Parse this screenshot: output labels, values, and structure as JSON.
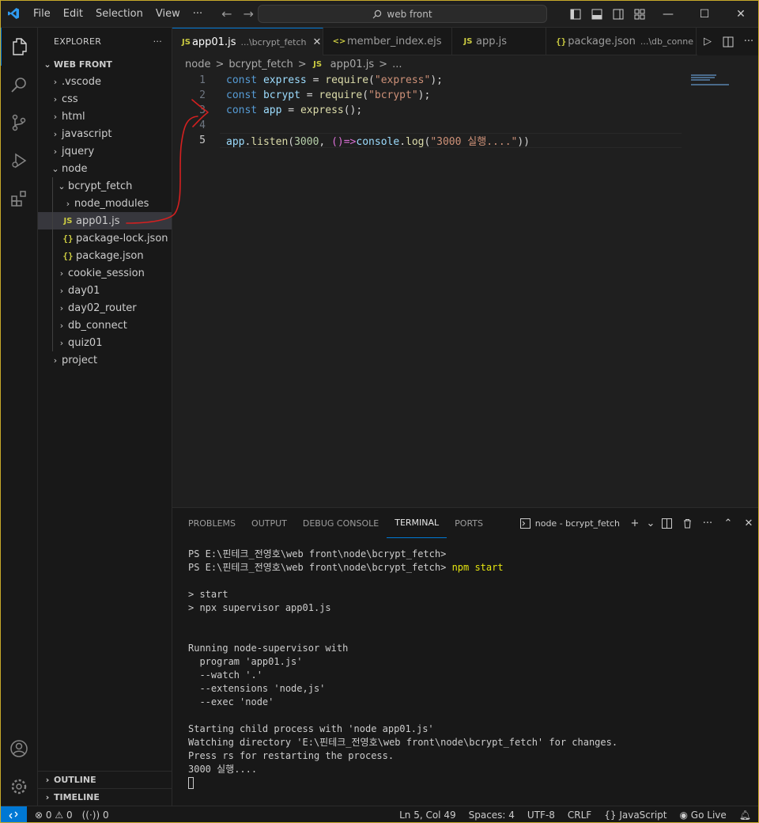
{
  "titlebar": {
    "menus": [
      "File",
      "Edit",
      "Selection",
      "View",
      "···"
    ],
    "search": "web front"
  },
  "sidebar": {
    "title": "EXPLORER",
    "more": "···",
    "folder": "WEB FRONT",
    "tree": [
      {
        "label": ".vscode",
        "level": 1,
        "type": "folder",
        "open": false
      },
      {
        "label": "css",
        "level": 1,
        "type": "folder",
        "open": false
      },
      {
        "label": "html",
        "level": 1,
        "type": "folder",
        "open": false
      },
      {
        "label": "javascript",
        "level": 1,
        "type": "folder",
        "open": false
      },
      {
        "label": "jquery",
        "level": 1,
        "type": "folder",
        "open": false
      },
      {
        "label": "node",
        "level": 1,
        "type": "folder",
        "open": true
      },
      {
        "label": "bcrypt_fetch",
        "level": 2,
        "type": "folder",
        "open": true
      },
      {
        "label": "node_modules",
        "level": 3,
        "type": "folder",
        "open": false
      },
      {
        "label": "app01.js",
        "level": 3,
        "type": "js",
        "selected": true
      },
      {
        "label": "package-lock.json",
        "level": 3,
        "type": "json"
      },
      {
        "label": "package.json",
        "level": 3,
        "type": "json"
      },
      {
        "label": "cookie_session",
        "level": 2,
        "type": "folder",
        "open": false
      },
      {
        "label": "day01",
        "level": 2,
        "type": "folder",
        "open": false
      },
      {
        "label": "day02_router",
        "level": 2,
        "type": "folder",
        "open": false
      },
      {
        "label": "db_connect",
        "level": 2,
        "type": "folder",
        "open": false
      },
      {
        "label": "quiz01",
        "level": 2,
        "type": "folder",
        "open": false
      },
      {
        "label": "project",
        "level": 1,
        "type": "folder",
        "open": false
      }
    ],
    "outline": "OUTLINE",
    "timeline": "TIMELINE"
  },
  "tabs": [
    {
      "label": "app01.js",
      "desc": "...\\bcrypt_fetch",
      "icon": "JS",
      "active": true,
      "close": "✕"
    },
    {
      "label": "member_index.ejs",
      "desc": "",
      "icon": "<>",
      "active": false
    },
    {
      "label": "app.js",
      "desc": "",
      "icon": "JS",
      "active": false
    },
    {
      "label": "package.json",
      "desc": "...\\db_conne",
      "icon": "{}",
      "active": false
    }
  ],
  "breadcrumb": [
    "node",
    ">",
    "bcrypt_fetch",
    ">",
    "app01.js",
    ">",
    "..."
  ],
  "editor": {
    "line_numbers": [
      "1",
      "2",
      "3",
      "4",
      "5"
    ],
    "line1": {
      "kw": "const",
      "var": "express",
      "op": " = ",
      "fn": "require",
      "open": "(",
      "str": "\"express\"",
      "close": ");"
    },
    "line2": {
      "kw": "const",
      "var": "bcrypt",
      "op": " = ",
      "fn": "require",
      "open": "(",
      "str": "\"bcrypt\"",
      "close": ");"
    },
    "line3": {
      "kw": "const",
      "var": "app",
      "op": " = ",
      "fn": "express",
      "close": "();"
    },
    "line5": {
      "var": "app",
      "dot": ".",
      "fn": "listen",
      "open": "(",
      "num": "3000",
      "comma": ", ",
      "arrow": "()=>",
      "obj": "console",
      "dot2": ".",
      "fn2": "log",
      "open2": "(",
      "str": "\"3000 실행....\"",
      "close": "))"
    }
  },
  "panel": {
    "tabs": [
      "PROBLEMS",
      "OUTPUT",
      "DEBUG CONSOLE",
      "TERMINAL",
      "PORTS"
    ],
    "active_tab": "TERMINAL",
    "terminal_name": "node - bcrypt_fetch",
    "terminal": {
      "l1": "PS E:\\핀테크_전영호\\web front\\node\\bcrypt_fetch>",
      "l2_prompt": "PS E:\\핀테크_전영호\\web front\\node\\bcrypt_fetch> ",
      "l2_cmd": "npm start",
      "l3": "> start",
      "l4": "> npx supervisor app01.js",
      "l5": "Running node-supervisor with",
      "l6": "  program 'app01.js'",
      "l7": "  --watch '.'",
      "l8": "  --extensions 'node,js'",
      "l9": "  --exec 'node'",
      "l10": "Starting child process with 'node app01.js'",
      "l11": "Watching directory 'E:\\핀테크_전영호\\web front\\node\\bcrypt_fetch' for changes.",
      "l12": "Press rs for restarting the process.",
      "l13": "3000 실행...."
    }
  },
  "statusbar": {
    "errors": "0",
    "warnings": "0",
    "ports": "0",
    "position": "Ln 5, Col 49",
    "spaces": "Spaces: 4",
    "encoding": "UTF-8",
    "eol": "CRLF",
    "language": "JavaScript",
    "golive": "Go Live"
  },
  "colors": {
    "accent": "#0078d4",
    "keyword": "#569cd6",
    "variable": "#9cdcfe",
    "function": "#dcdcaa",
    "string": "#ce9178",
    "annotation": "#d42020"
  }
}
